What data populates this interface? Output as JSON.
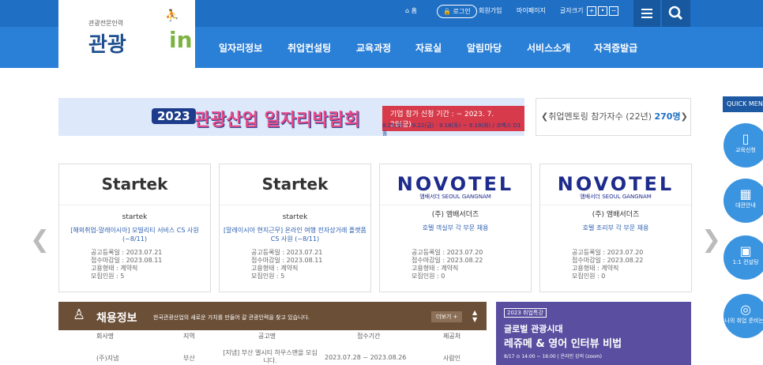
{
  "logo": {
    "tagline": "관광전문인력",
    "word": "관광",
    "in": "in"
  },
  "util": {
    "home": "홈",
    "login": "로그인",
    "signup": "회원가입",
    "mypage": "마이페이지",
    "fontsize": "글자크기",
    "plus": "+",
    "dot": "•",
    "minus": "−"
  },
  "nav": [
    "일자리정보",
    "취업컨설팅",
    "교육과정",
    "자료실",
    "알림마당",
    "서비스소개",
    "자격증발급"
  ],
  "banner": {
    "year": "2023",
    "title": "관광산업 일자리박람회",
    "apply": "기업 참가 신청 기간 : ~ 2023. 7. 28(금)",
    "small": "8.26(토) ~ 9.22(금) · 9.16(토) ~ 9.19(화) / 코엑스 D1홀"
  },
  "counter": {
    "text": "취업멘토링 참가자수 (22년)",
    "value": "270명"
  },
  "cards": [
    {
      "logo": "Startek",
      "sub": "",
      "company": "startek",
      "title": "[해외취업-말레이시아] 모빌리티 서비스 CS 사원 (~8/11)",
      "reg": "공고등록일 : 2023.07.21",
      "due": "접수마감일 : 2023.08.11",
      "type": "고용형태 : 계약직",
      "num": "모집인원 : 5"
    },
    {
      "logo": "Startek",
      "sub": "",
      "company": "startek",
      "title": "[말레이시아 현지근무] 온라인 여행 전자상거래 플랫폼 CS 사원 (~8/11)",
      "reg": "공고등록일 : 2023.07.21",
      "due": "접수마감일 : 2023.08.11",
      "type": "고용형태 : 계약직",
      "num": "모집인원 : 5"
    },
    {
      "logo": "NOVOTEL",
      "sub": "앰배서더 SEOUL GANGNAM",
      "company": "(주) 앰배서더즈",
      "title": "호텔 객실부 각 부문 채용",
      "reg": "공고등록일 : 2023.07.20",
      "due": "접수마감일 : 2023.08.22",
      "type": "고용형태 : 계약직",
      "num": "모집인원 : 0"
    },
    {
      "logo": "NOVOTEL",
      "sub": "앰배서더 SEOUL GANGNAM",
      "company": "(주) 앰배서더즈",
      "title": "호텔 조리부 각 부문 채용",
      "reg": "공고등록일 : 2023.07.20",
      "due": "접수마감일 : 2023.08.22",
      "type": "고용형태 : 계약직",
      "num": "모집인원 : 0"
    }
  ],
  "quick": {
    "title": "QUICK MENU",
    "items": [
      "교육신청",
      "대관안내",
      "1:1 컨설팅",
      "나의 취업 준비는?"
    ]
  },
  "jobs": {
    "title": "채용정보",
    "desc": "한국관광산업의 새로운 가치를 만들어 갈 관광인력을 찾고 있습니다.",
    "more": "더보기 +",
    "cols": [
      "회사명",
      "지역",
      "공고명",
      "접수기간",
      "제공처"
    ],
    "row": {
      "company": "(주)지냄",
      "region": "부산",
      "title": "[지냄] 부산 엘시티 하우스맨을 모십니다.",
      "period": "2023.07.28 ~ 2023.08.26",
      "source": "사람인"
    }
  },
  "promo": {
    "tag": "2023 취업특강",
    "title": "글로벌 관광시대",
    "title2": "레쥬메 & 영어 인터뷰 비법",
    "date": "8/17 ⊙ 14:00 ~ 16:00 | 온라인 강의 (zoom)"
  }
}
